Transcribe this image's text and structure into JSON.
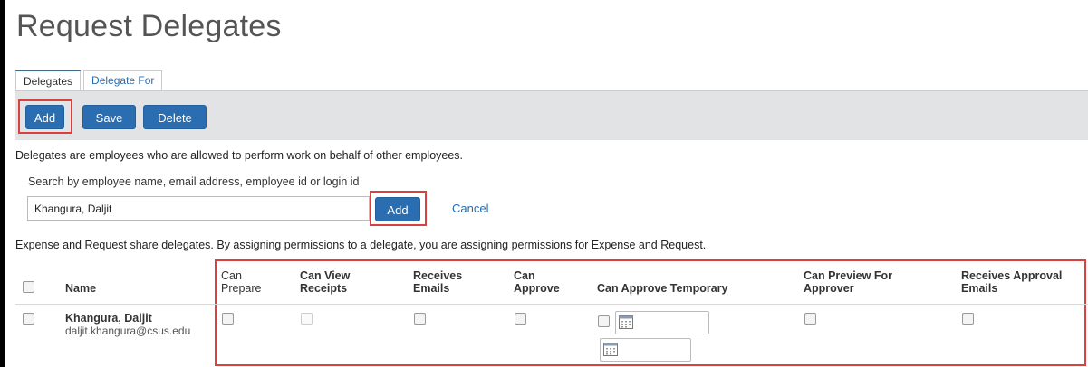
{
  "page": {
    "title": "Request Delegates"
  },
  "tabs": [
    {
      "label": "Delegates",
      "active": true
    },
    {
      "label": "Delegate For",
      "active": false
    }
  ],
  "toolbar": {
    "add_label": "Add",
    "save_label": "Save",
    "delete_label": "Delete"
  },
  "description": "Delegates are employees who are allowed to perform work on behalf of other employees.",
  "search": {
    "label": "Search by employee name, email address, employee id or login id",
    "value": "Khangura, Daljit",
    "add_label": "Add",
    "cancel_label": "Cancel"
  },
  "note": "Expense and Request share delegates. By assigning permissions to a delegate, you are assigning permissions for Expense and Request.",
  "table": {
    "columns": {
      "name": "Name",
      "can_prepare": [
        "Can",
        "Prepare"
      ],
      "can_view_receipts": [
        "Can View",
        "Receipts"
      ],
      "receives_emails": [
        "Receives",
        "Emails"
      ],
      "can_approve": [
        "Can",
        "Approve"
      ],
      "can_approve_temporary": "Can Approve Temporary",
      "can_preview_for_approver": [
        "Can Preview For",
        "Approver"
      ],
      "receives_approval_emails": [
        "Receives Approval",
        "Emails"
      ]
    },
    "rows": [
      {
        "name": "Khangura, Daljit",
        "email": "daljit.khangura@csus.edu"
      }
    ]
  },
  "colors": {
    "accent": "#2a6db0",
    "highlight": "#d9403f",
    "toolbar_bg": "#e1e3e5"
  }
}
